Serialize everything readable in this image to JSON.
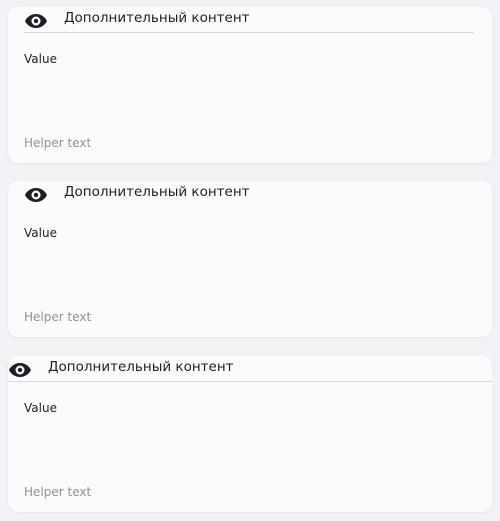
{
  "cards": [
    {
      "icon": "eye-icon",
      "title": "Дополнительный контент",
      "value": "Value",
      "helper": "Helper text"
    },
    {
      "icon": "eye-icon",
      "title": "Дополнительный контент",
      "value": "Value",
      "helper": "Helper text"
    },
    {
      "icon": "eye-icon",
      "title": "Дополнительный контент",
      "value": "Value",
      "helper": "Helper text"
    }
  ],
  "colors": {
    "background": "#f1f2f5",
    "card": "#fbfbfd",
    "text": "#1d1f24",
    "helper": "#8e929b",
    "divider": "#d7d9de"
  }
}
